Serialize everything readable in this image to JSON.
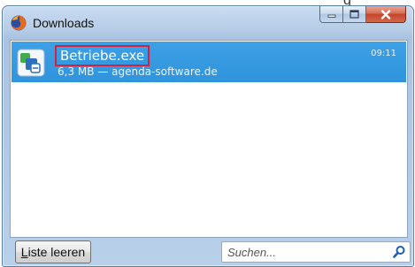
{
  "top_remnant_text": "g",
  "window": {
    "title": "Downloads"
  },
  "downloads": [
    {
      "name": "Betriebe.exe",
      "meta": "6,3 MB — agenda-software.de",
      "time": "09:11",
      "icon": "installer-icon"
    }
  ],
  "bottom": {
    "clear_label_underlined": "L",
    "clear_label_rest": "iste leeren",
    "search_placeholder": "Suchen..."
  },
  "colors": {
    "selection": "#3399e0",
    "highlight_border": "#d4213d",
    "close_button": "#c4452b"
  }
}
